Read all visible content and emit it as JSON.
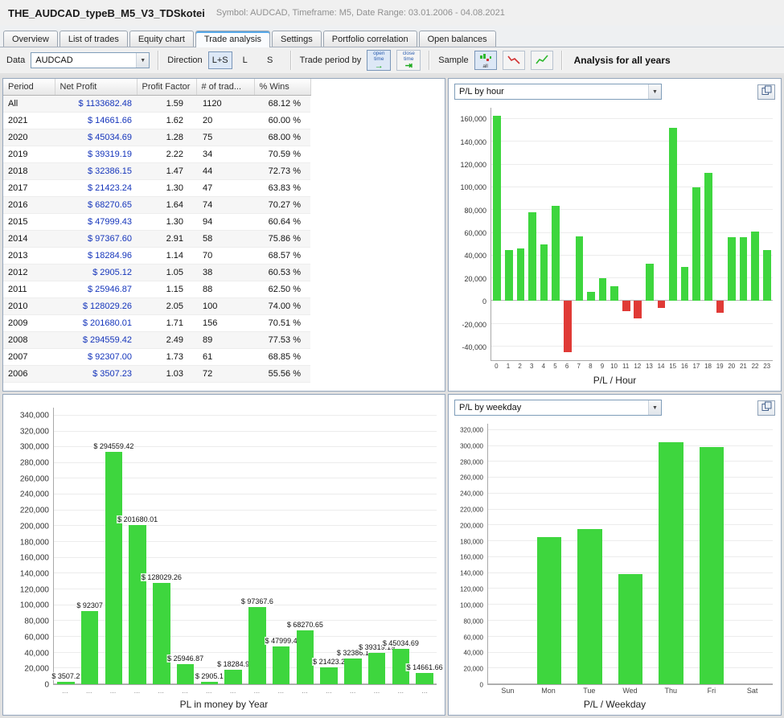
{
  "colors": {
    "bar_green": "#3ed63e",
    "bar_red": "#e03a36",
    "profit_text": "#1535bb"
  },
  "header": {
    "title": "THE_AUDCAD_typeB_M5_V3_TDSkotei",
    "subtitle": "Symbol: AUDCAD, Timeframe: M5, Date Range: 03.01.2006 - 04.08.2021"
  },
  "tabs": {
    "active_index": 3,
    "items": [
      "Overview",
      "List of trades",
      "Equity chart",
      "Trade analysis",
      "Settings",
      "Portfolio correlation",
      "Open balances"
    ]
  },
  "toolbar": {
    "data_label": "Data",
    "data_value": "AUDCAD",
    "direction_label": "Direction",
    "direction_options": [
      "L+S",
      "L",
      "S"
    ],
    "direction_selected": "L+S",
    "trade_period_label": "Trade period by",
    "trade_period_buttons": [
      "open time",
      "close time"
    ],
    "sample_label": "Sample",
    "sample_all_label": "all",
    "analysis_label": "Analysis for all years"
  },
  "table": {
    "columns": [
      "Period",
      "Net Profit",
      "Profit Factor",
      "# of trad...",
      "% Wins"
    ],
    "rows": [
      [
        "All",
        "$ 1133682.48",
        "1.59",
        "1120",
        "68.12 %"
      ],
      [
        "2021",
        "$ 14661.66",
        "1.62",
        "20",
        "60.00 %"
      ],
      [
        "2020",
        "$ 45034.69",
        "1.28",
        "75",
        "68.00 %"
      ],
      [
        "2019",
        "$ 39319.19",
        "2.22",
        "34",
        "70.59 %"
      ],
      [
        "2018",
        "$ 32386.15",
        "1.47",
        "44",
        "72.73 %"
      ],
      [
        "2017",
        "$ 21423.24",
        "1.30",
        "47",
        "63.83 %"
      ],
      [
        "2016",
        "$ 68270.65",
        "1.64",
        "74",
        "70.27 %"
      ],
      [
        "2015",
        "$ 47999.43",
        "1.30",
        "94",
        "60.64 %"
      ],
      [
        "2014",
        "$ 97367.60",
        "2.91",
        "58",
        "75.86 %"
      ],
      [
        "2013",
        "$ 18284.96",
        "1.14",
        "70",
        "68.57 %"
      ],
      [
        "2012",
        "$ 2905.12",
        "1.05",
        "38",
        "60.53 %"
      ],
      [
        "2011",
        "$ 25946.87",
        "1.15",
        "88",
        "62.50 %"
      ],
      [
        "2010",
        "$ 128029.26",
        "2.05",
        "100",
        "74.00 %"
      ],
      [
        "2009",
        "$ 201680.01",
        "1.71",
        "156",
        "70.51 %"
      ],
      [
        "2008",
        "$ 294559.42",
        "2.49",
        "89",
        "77.53 %"
      ],
      [
        "2007",
        "$ 92307.00",
        "1.73",
        "61",
        "68.85 %"
      ],
      [
        "2006",
        "$ 3507.23",
        "1.03",
        "72",
        "55.56 %"
      ]
    ]
  },
  "chart_data": [
    {
      "id": "hour",
      "type": "bar",
      "title": "P/L by hour",
      "xlabel": "P/L / Hour",
      "categories": [
        "0",
        "1",
        "2",
        "3",
        "4",
        "5",
        "6",
        "7",
        "8",
        "9",
        "10",
        "11",
        "12",
        "13",
        "14",
        "15",
        "16",
        "17",
        "18",
        "19",
        "20",
        "21",
        "22",
        "23"
      ],
      "values": [
        163000,
        45000,
        46000,
        78000,
        50000,
        84000,
        -45000,
        57000,
        8000,
        20000,
        13000,
        -9000,
        -15000,
        33000,
        -6000,
        152000,
        30000,
        100000,
        113000,
        -10000,
        56000,
        56000,
        61000,
        45000
      ],
      "ylim": [
        -52000,
        170000
      ],
      "ytick_step": 20000,
      "grid": true,
      "legend": false
    },
    {
      "id": "year",
      "type": "bar",
      "title": "PL in money by Year",
      "xlabel": "PL in money by Year",
      "categories": [
        "...",
        "...",
        "...",
        "...",
        "...",
        "...",
        "...",
        "...",
        "...",
        "...",
        "...",
        "...",
        "...",
        "...",
        "...",
        "..."
      ],
      "values": [
        3507.23,
        92307.0,
        294559.42,
        201680.01,
        128029.26,
        25946.87,
        2905.12,
        18284.96,
        97367.6,
        47999.43,
        68270.65,
        21423.24,
        32386.15,
        39319.19,
        45034.69,
        14661.66
      ],
      "data_labels": [
        "$ 3507.2",
        "$ 92307",
        "$ 294559.42",
        "$ 201680.01",
        "$ 128029.26",
        "$ 25946.87",
        "$ 2905.1",
        "$ 18284.9",
        "$ 97367.6",
        "$ 47999.4",
        "$ 68270.65",
        "$ 21423.2",
        "$ 32386.1",
        "$ 39319.19",
        "$ 45034.69",
        "$ 14661.66"
      ],
      "ylim": [
        0,
        350000
      ],
      "ytick_step": 20000,
      "grid": true,
      "legend": false
    },
    {
      "id": "weekday",
      "type": "bar",
      "title": "P/L by weekday",
      "xlabel": "P/L / Weekday",
      "categories": [
        "Sun",
        "Mon",
        "Tue",
        "Wed",
        "Thu",
        "Fri",
        "Sat"
      ],
      "values": [
        0,
        185000,
        195000,
        139000,
        305000,
        299000,
        0
      ],
      "ylim": [
        0,
        328000
      ],
      "ytick_step": 20000,
      "grid": true,
      "legend": false
    }
  ]
}
